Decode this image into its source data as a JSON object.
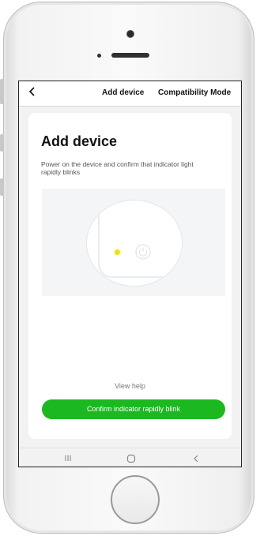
{
  "navbar": {
    "back_icon": "chevron-left-icon",
    "title": "Add device",
    "action": "Compatibility Mode"
  },
  "card": {
    "title": "Add device",
    "description": "Power on the device and confirm that indicator light rapidly blinks",
    "illustration": {
      "indicator_color": "#f0e01c",
      "power_icon": "power-icon"
    },
    "help_link": "View help",
    "confirm_button": "Confirm indicator rapidly blink"
  },
  "android_nav": {
    "recents_glyph": "III",
    "home_glyph": "O",
    "back_glyph": "<"
  },
  "colors": {
    "accent": "#1bb91f",
    "indicator": "#f0e01c"
  }
}
